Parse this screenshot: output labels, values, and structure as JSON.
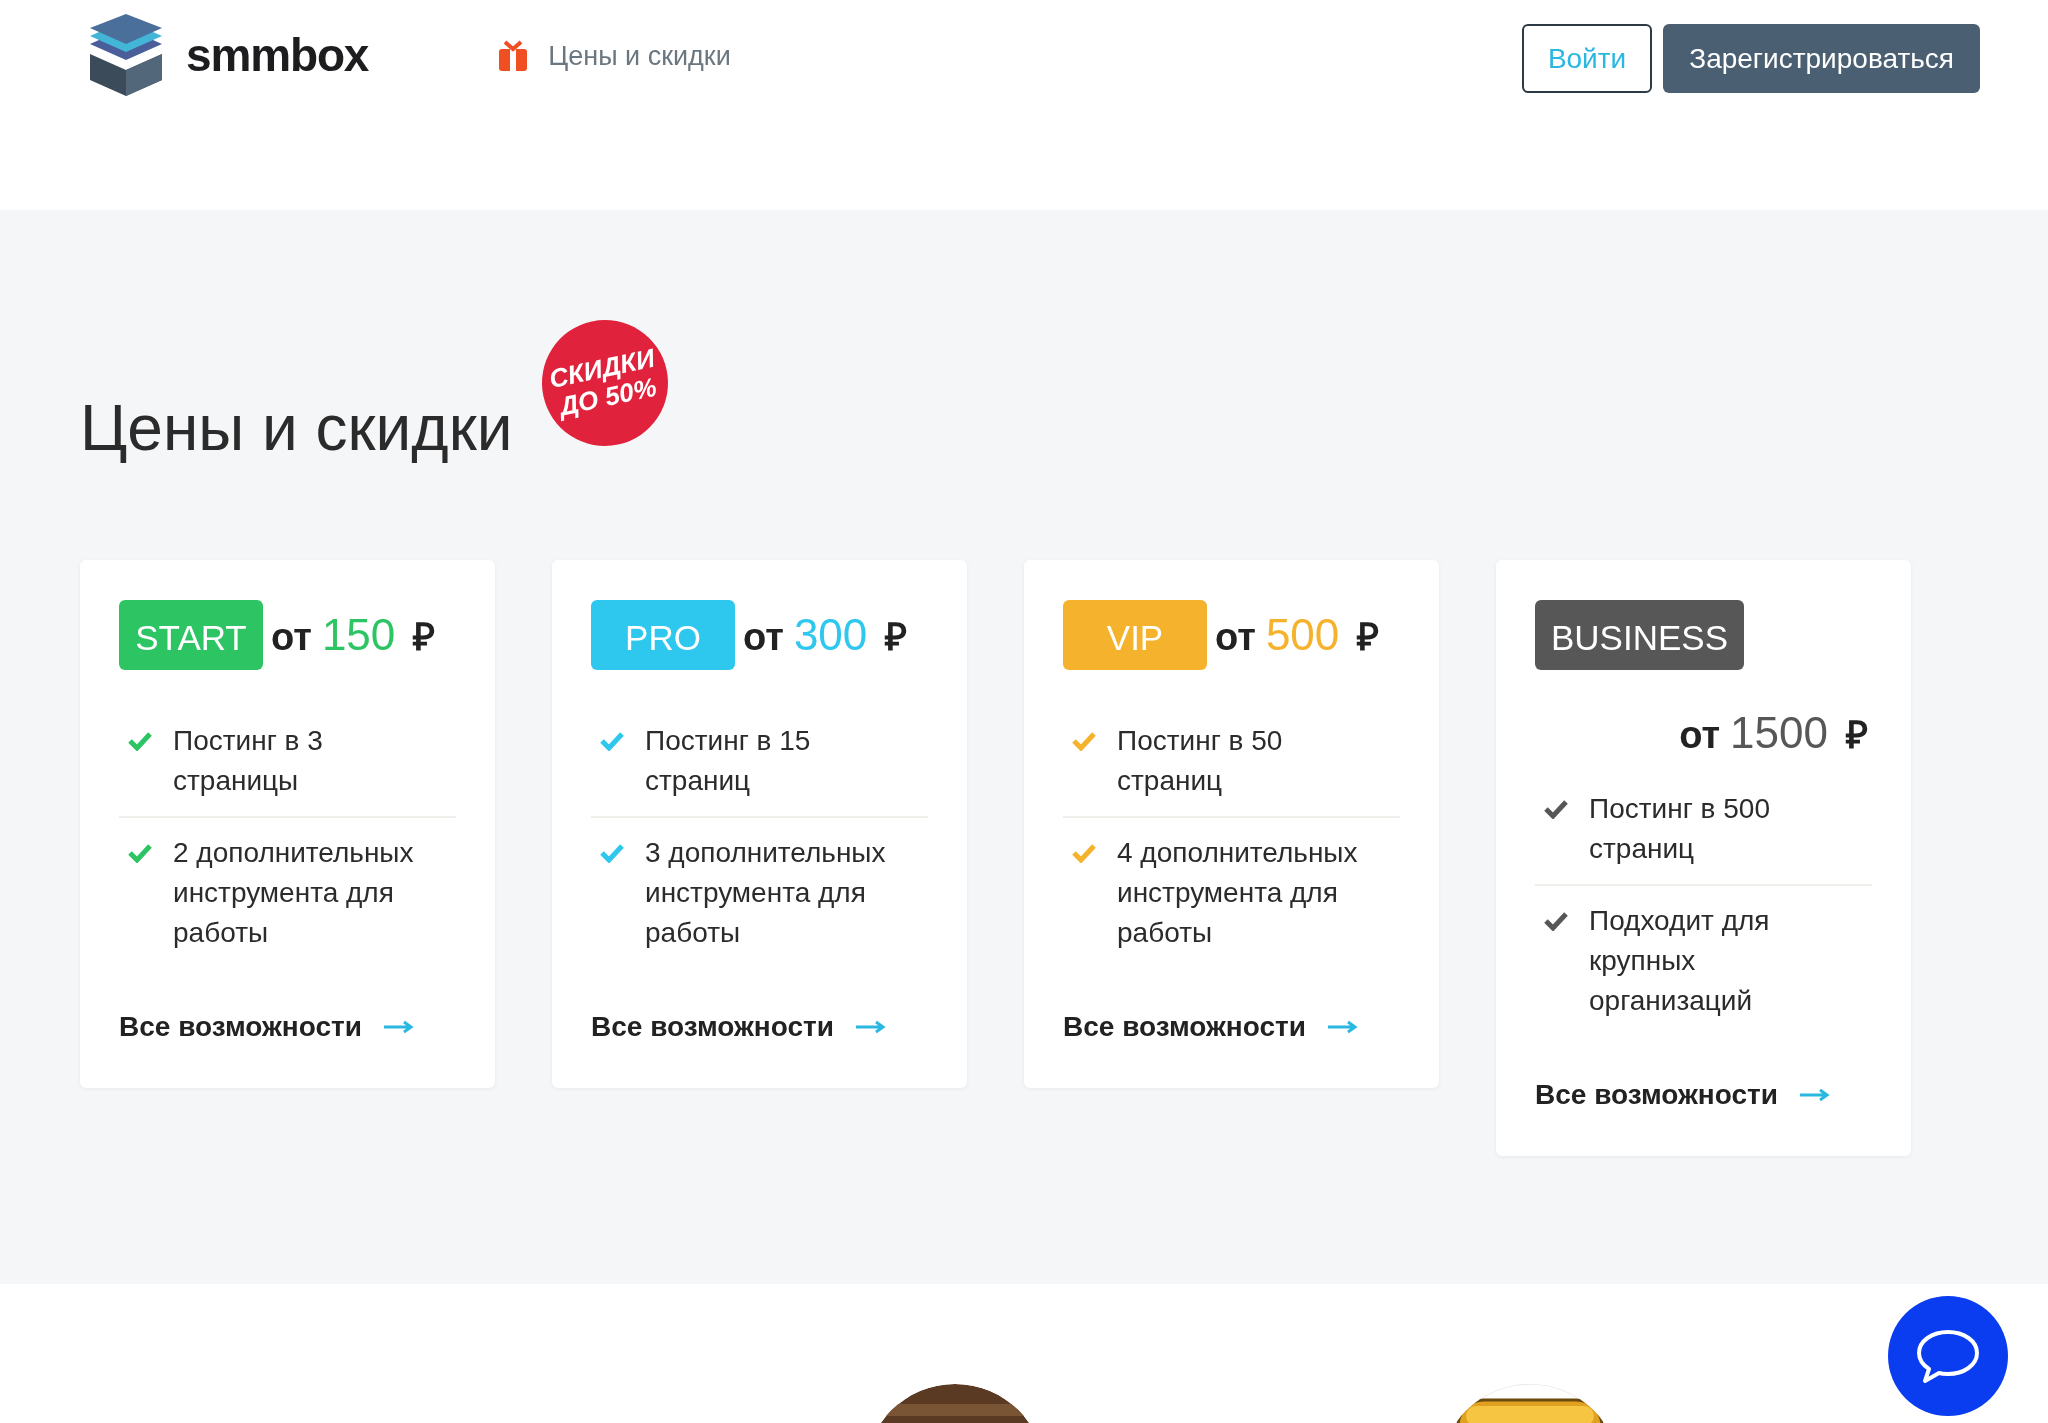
{
  "header": {
    "logo_text": "smmbox",
    "nav": [
      {
        "label": "Цены и скидки"
      }
    ],
    "login": "Войти",
    "register": "Зарегистрироваться"
  },
  "section": {
    "title": "Цены и скидки",
    "sticker": [
      "СКИДКИ",
      "ДО 50%"
    ]
  },
  "plans": [
    {
      "kind": "inline",
      "tag": "START",
      "color": "#2dc564",
      "prefix": "от",
      "price": "150",
      "currency": "₽",
      "features": [
        "Постинг в 3 страницы",
        "2 дополнительных инструмента для работы"
      ],
      "link": "Все возможности"
    },
    {
      "kind": "inline",
      "tag": "PRO",
      "color": "#2ec7ee",
      "prefix": "от",
      "price": "300",
      "currency": "₽",
      "features": [
        "Постинг в 15 страниц",
        "3 дополнительных инструмента для работы"
      ],
      "link": "Все возможности"
    },
    {
      "kind": "inline",
      "tag": "VIP",
      "color": "#f5b22d",
      "prefix": "от",
      "price": "500",
      "currency": "₽",
      "features": [
        "Постинг в 50 страниц",
        "4 дополнительных инструмента для работы"
      ],
      "link": "Все возможности"
    },
    {
      "kind": "stacked",
      "tag": "BUSINESS",
      "color": "#575757",
      "prefix": "от",
      "price": "1500",
      "currency": "₽",
      "features": [
        "Постинг в 500 страниц",
        "Подходит для крупных организаций"
      ],
      "link": "Все возможности"
    }
  ]
}
